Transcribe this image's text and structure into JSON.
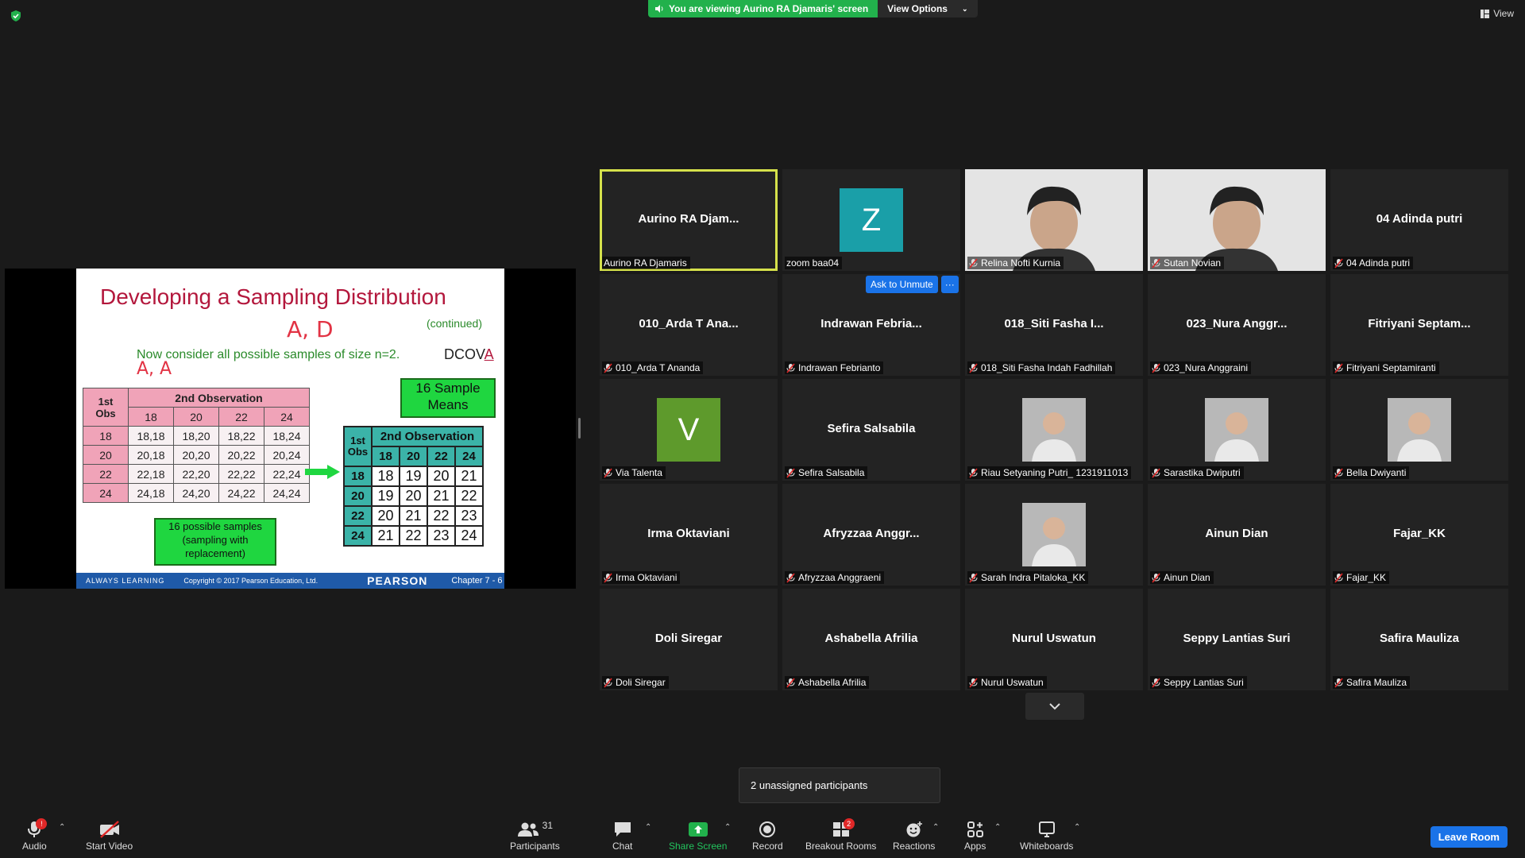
{
  "banner": {
    "text": "You are viewing Aurino RA Djamaris' screen",
    "options": "View Options"
  },
  "view_label": "View",
  "slide": {
    "title": "Developing a Sampling Distribution",
    "continued": "(continued)",
    "line": "Now consider all possible samples of size n=2.",
    "dcova_prefix": "DCOV",
    "dcova_suffix": "A",
    "handwriting": [
      "A, D",
      "A, A"
    ],
    "table1": {
      "corner_top": "1st",
      "corner_bottom": "Obs",
      "header": "2nd Observation",
      "cols": [
        "18",
        "20",
        "22",
        "24"
      ],
      "rows": [
        {
          "label": "18",
          "cells": [
            "18,18",
            "18,20",
            "18,22",
            "18,24"
          ]
        },
        {
          "label": "20",
          "cells": [
            "20,18",
            "20,20",
            "20,22",
            "20,24"
          ]
        },
        {
          "label": "22",
          "cells": [
            "22,18",
            "22,20",
            "22,22",
            "22,24"
          ]
        },
        {
          "label": "24",
          "cells": [
            "24,18",
            "24,20",
            "24,22",
            "24,24"
          ]
        }
      ]
    },
    "table2": {
      "corner_top": "1st",
      "corner_bottom": "Obs",
      "header": "2nd Observation",
      "cols": [
        "18",
        "20",
        "22",
        "24"
      ],
      "rows": [
        {
          "label": "18",
          "cells": [
            "18",
            "19",
            "20",
            "21"
          ]
        },
        {
          "label": "20",
          "cells": [
            "19",
            "20",
            "21",
            "22"
          ]
        },
        {
          "label": "22",
          "cells": [
            "20",
            "21",
            "22",
            "23"
          ]
        },
        {
          "label": "24",
          "cells": [
            "21",
            "22",
            "23",
            "24"
          ]
        }
      ]
    },
    "box_means": "16 Sample Means",
    "box_samples": "16 possible samples (sampling with replacement)",
    "footer": {
      "left": "ALWAYS LEARNING",
      "copyright": "Copyright © 2017 Pearson Education, Ltd.",
      "brand": "PEARSON",
      "chapter": "Chapter 7 - 6"
    }
  },
  "participants": [
    {
      "tile_name": "Aurino RA Djam...",
      "label": "Aurino RA Djamaris",
      "muted": false,
      "active": true
    },
    {
      "avatar": "Z",
      "avatar_color": "#1a9fa8",
      "label": "zoom baa04",
      "muted": false
    },
    {
      "photo": "person-video",
      "label": "Relina Nofti Kurnia",
      "muted": true
    },
    {
      "photo": "person-video",
      "label": "Sutan Novian",
      "muted": true
    },
    {
      "tile_name": "04 Adinda putri",
      "label": "04 Adinda putri",
      "muted": true
    },
    {
      "tile_name": "010_Arda T Ana...",
      "label": "010_Arda T Ananda",
      "muted": true
    },
    {
      "tile_name": "Indrawan  Febria...",
      "label": "Indrawan Febrianto",
      "muted": true
    },
    {
      "tile_name": "018_Siti Fasha I...",
      "label": "018_Siti Fasha Indah Fadhillah",
      "muted": true
    },
    {
      "tile_name": "023_Nura Anggr...",
      "label": "023_Nura Anggraini",
      "muted": true
    },
    {
      "tile_name": "Fitriyani  Septam...",
      "label": "Fitriyani Septamiranti",
      "muted": true
    },
    {
      "avatar": "V",
      "avatar_color": "#5e9a2c",
      "label": "Via Talenta",
      "muted": true
    },
    {
      "tile_name": "Sefira Salsabila",
      "label": "Sefira Salsabila",
      "muted": true
    },
    {
      "photo": "profile-photo",
      "label": "Riau Setyaning Putri_ 1231911013",
      "muted": true
    },
    {
      "photo": "profile-photo",
      "label": "Sarastika Dwiputri",
      "muted": true
    },
    {
      "photo": "profile-photo",
      "label": "Bella Dwiyanti",
      "muted": true
    },
    {
      "tile_name": "Irma Oktaviani",
      "label": "Irma Oktaviani",
      "muted": true
    },
    {
      "tile_name": "Afryzzaa  Anggr...",
      "label": "Afryzzaa Anggraeni",
      "muted": true
    },
    {
      "photo": "profile-photo",
      "label": "Sarah Indra Pitaloka_KK",
      "muted": true
    },
    {
      "tile_name": "Ainun Dian",
      "label": "Ainun Dian",
      "muted": true
    },
    {
      "tile_name": "Fajar_KK",
      "label": "Fajar_KK",
      "muted": true
    },
    {
      "tile_name": "Doli Siregar",
      "label": "Doli Siregar",
      "muted": true
    },
    {
      "tile_name": "Ashabella Afrilia",
      "label": "Ashabella Afrilia",
      "muted": true
    },
    {
      "tile_name": "Nurul Uswatun",
      "label": "Nurul Uswatun",
      "muted": true
    },
    {
      "tile_name": "Seppy Lantias Suri",
      "label": "Seppy Lantias Suri",
      "muted": true
    },
    {
      "tile_name": "Safira Mauliza",
      "label": "Safira Mauliza",
      "muted": true
    }
  ],
  "ask_to_unmute": "Ask to Unmute",
  "more_dots": "···",
  "unassigned": "2 unassigned participants",
  "toolbar": {
    "audio": "Audio",
    "audio_badge": "!",
    "video": "Start Video",
    "participants": "Participants",
    "participants_count": "31",
    "chat": "Chat",
    "share": "Share Screen",
    "record": "Record",
    "breakout": "Breakout Rooms",
    "breakout_badge": "2",
    "reactions": "Reactions",
    "apps": "Apps",
    "whiteboards": "Whiteboards",
    "leave": "Leave Room"
  },
  "colors": {
    "share_green": "#22b14c",
    "active_border": "#d5e14b",
    "accent_blue": "#1a73e8",
    "slide_red": "#b3173c"
  }
}
